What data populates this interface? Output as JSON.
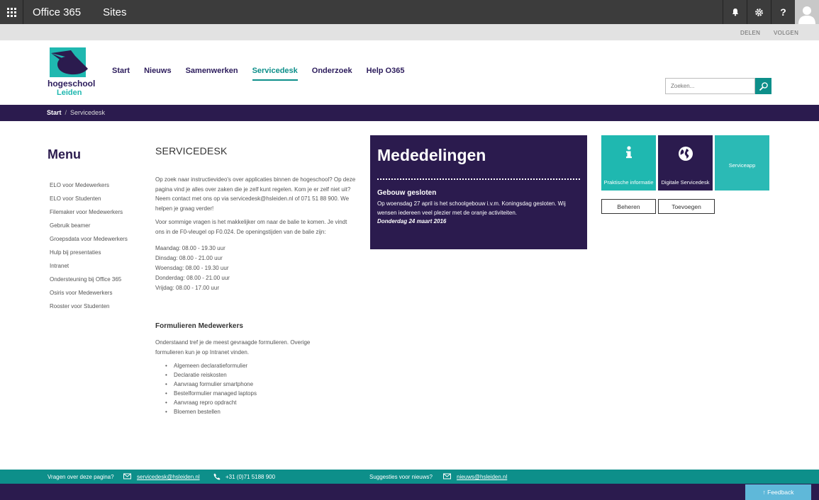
{
  "suite": {
    "brand": "Office 365",
    "sites": "Sites",
    "icons": [
      "waffle-icon",
      "bell-icon",
      "gear-icon",
      "help-icon",
      "avatar-icon"
    ],
    "help_label": "?"
  },
  "subbar": {
    "share": "DELEN",
    "follow": "VOLGEN"
  },
  "logo": {
    "line1": "hogeschool",
    "line2": "Leiden"
  },
  "nav": [
    {
      "label": "Start",
      "active": false
    },
    {
      "label": "Nieuws",
      "active": false
    },
    {
      "label": "Samenwerken",
      "active": false
    },
    {
      "label": "Servicedesk",
      "active": true
    },
    {
      "label": "Onderzoek",
      "active": false
    },
    {
      "label": "Help O365",
      "active": false
    }
  ],
  "search": {
    "placeholder": "Zoeken..."
  },
  "breadcrumb": {
    "home": "Start",
    "separator": "/",
    "current": "Servicedesk"
  },
  "menu": {
    "title": "Menu",
    "items": [
      "ELO voor Medewerkers",
      "ELO voor Studenten",
      "Filemaker voor Medewerkers",
      "Gebruik beamer",
      "Groepsdata voor Medewerkers",
      "Hulp bij presentaties",
      "Intranet",
      "Ondersteuning bij Office 365",
      "Osiris voor Medewerkers",
      "Rooster voor Studenten"
    ]
  },
  "content": {
    "title": "SERVICEDESK",
    "para1": "Op zoek naar instructievideo's over applicaties binnen de hogeschool? Op deze pagina vind je alles over zaken die je zelf kunt regelen. Kom je er zelf niet uit? Neem contact met ons op via servicedesk@hsleiden.nl of 071 51 88 900. We helpen je graag verder!",
    "para2": "Voor sommige vragen is het makkelijker om naar de balie te komen. Je vindt ons in de F0-vleugel op F0.024. De openingstijden van de balie zijn:",
    "hours": [
      "Maandag: 08.00 - 19.30 uur",
      "Dinsdag: 08.00 - 21.00 uur",
      "Woensdag: 08.00 - 19.30 uur",
      "Donderdag: 08.00 - 21.00 uur",
      "Vrijdag: 08.00 - 17.00 uur"
    ],
    "forms_title": "Formulieren Medewerkers",
    "forms_intro": "Onderstaand tref je de meest gevraagde formulieren. Overige formulieren kun je op Intranet vinden.",
    "forms": [
      "Algemeen declaratieformulier",
      "Declaratie reiskosten",
      "Aanvraag formulier smartphone",
      "Bestelformulier managed laptops",
      "Aanvraag repro opdracht",
      "Bloemen bestellen"
    ]
  },
  "announcements": {
    "title": "Mededelingen",
    "item_title": "Gebouw gesloten",
    "item_body": "Op woensdag 27 april is het schoolgebouw i.v.m. Koningsdag gesloten. Wij wensen iedereen veel plezier met de oranje activiteiten.",
    "item_date": "Donderdag 24 maart 2016"
  },
  "tiles": [
    {
      "label": "Praktische informatie",
      "icon": "info-icon",
      "color": "#1fb8b0"
    },
    {
      "label": "Digitale Servicedesk",
      "icon": "globe-icon",
      "color": "#2b1b4e"
    },
    {
      "label": "Serviceapp",
      "icon": "",
      "color": "#2bbab5"
    }
  ],
  "tile_buttons": {
    "manage": "Beheren",
    "add": "Toevoegen"
  },
  "footer": {
    "question": "Vragen over deze pagina?",
    "email": "servicedesk@hsleiden.nl",
    "phone": "+31 (0)71 5188 900",
    "news_question": "Suggesties voor nieuws?",
    "news_email": "nieuws@hsleiden.nl",
    "feedback": "↑ Feedback"
  },
  "colors": {
    "purple": "#2b1b4e",
    "teal": "#0d8f8a",
    "light_teal": "#1fb8b0",
    "suitebar": "#3c3c3c"
  }
}
